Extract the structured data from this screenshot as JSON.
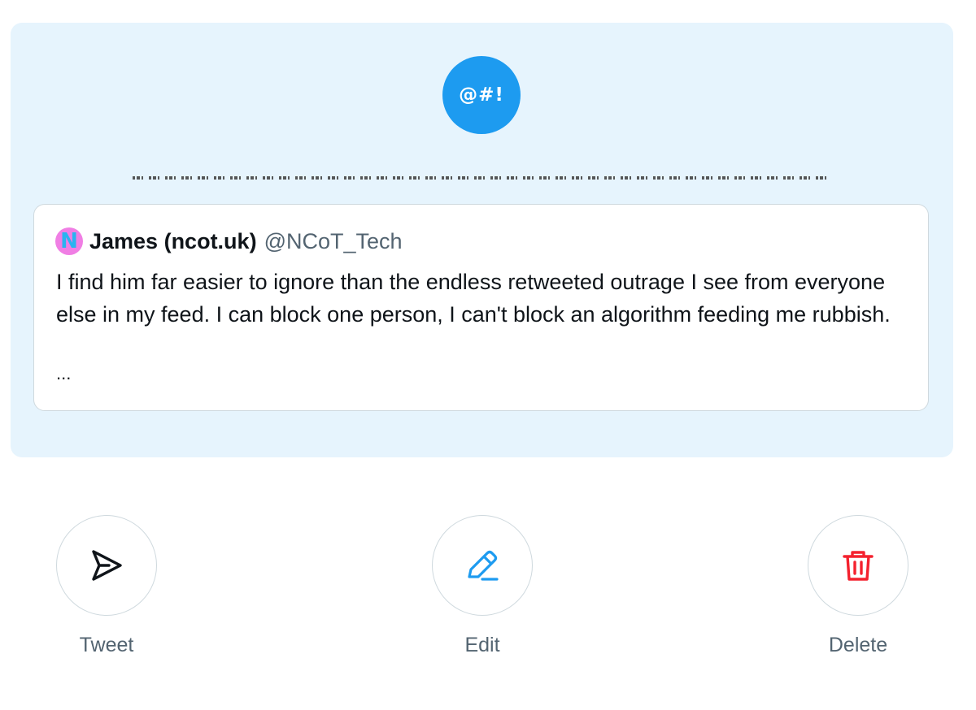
{
  "preview": {
    "app_badge_text": "@#!",
    "quoted_tweet": {
      "author_name": "James (ncot.uk)",
      "author_handle": "@NCoT_Tech",
      "avatar_letter": "N",
      "body": "I find him far easier to ignore than the endless retweeted outrage I see from everyone else in my feed. I can block one person, I can't block an algorithm feeding me rubbish.",
      "ellipsis": "..."
    }
  },
  "actions": [
    {
      "label": "Tweet",
      "icon": "send-icon",
      "color": "#0f1419"
    },
    {
      "label": "Edit",
      "icon": "pencil-icon",
      "color": "#1d9bf0"
    },
    {
      "label": "Delete",
      "icon": "trash-icon",
      "color": "#f4212e"
    }
  ],
  "colors": {
    "accent": "#1d9bf0",
    "card_background": "#e6f4fd",
    "danger": "#f4212e",
    "secondary_text": "#536471"
  }
}
